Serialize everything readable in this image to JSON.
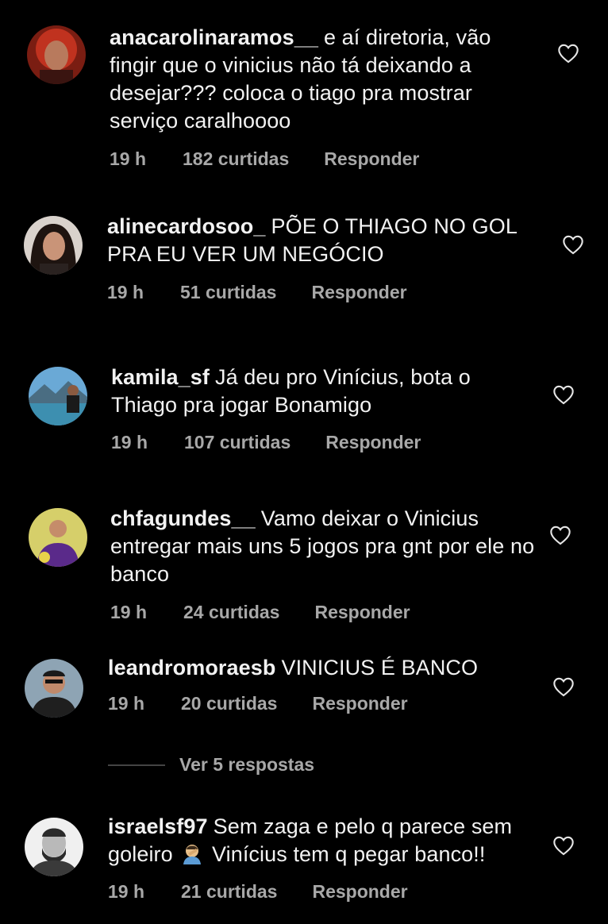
{
  "comments": [
    {
      "username": "anacarolinaramos__",
      "text": "e aí diretoria, vão fingir que o vinicius não tá deixando a desejar??? coloca o tiago pra mostrar serviço caralhoooo",
      "time": "19 h",
      "likes": "182 curtidas",
      "reply": "Responder"
    },
    {
      "username": "alinecardosoo_",
      "text": "PÕE O THIAGO NO GOL PRA EU VER UM NEGÓCIO",
      "time": "19 h",
      "likes": "51 curtidas",
      "reply": "Responder"
    },
    {
      "username": "kamila_sf",
      "text": "Já deu pro Vinícius, bota o Thiago pra jogar Bonamigo",
      "time": "19 h",
      "likes": "107 curtidas",
      "reply": "Responder"
    },
    {
      "username": "chfagundes__",
      "text": "Vamo deixar o Vinicius entregar mais uns 5 jogos pra gnt por ele no banco",
      "time": "19 h",
      "likes": "24 curtidas",
      "reply": "Responder"
    },
    {
      "username": "leandromoraesb",
      "text": "VINICIUS É BANCO",
      "time": "19 h",
      "likes": "20 curtidas",
      "reply": "Responder"
    },
    {
      "username": "israelsf97",
      "text_before": "Sem zaga e pelo q parece sem goleiro",
      "text_after": "Vinícius tem q pegar banco!!",
      "time": "19 h",
      "likes": "21 curtidas",
      "reply": "Responder"
    }
  ],
  "view_replies": "Ver 5 respostas",
  "colors": {
    "background": "#000000",
    "text": "#f2f2f2",
    "meta": "#a8a8a8"
  },
  "icons": {
    "like": "heart-outline-icon",
    "emoji": "facepalm-emoji"
  }
}
